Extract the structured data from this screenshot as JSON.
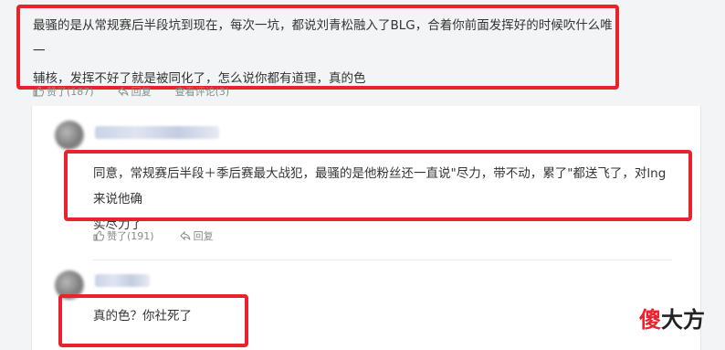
{
  "top_comment": {
    "text_line1": "最骚的是从常规赛后半段坑到现在，每次一坑，都说刘青松融入了BLG，合着你前面发挥好的时候吹什么唯一",
    "text_line2": "辅核，发挥不好了就是被同化了，怎么说你都有道理，真的色",
    "likes": "赞了(187)",
    "reply": "回复",
    "view_replies": "查看评论(3)"
  },
  "reply_1": {
    "text_line1": "同意，常规赛后半段＋季后赛最大战犯，最骚的是他粉丝还一直说\"尽力，带不动，累了\"都送飞了，对lng来说他确",
    "text_line2": "实尽力了",
    "likes": "赞了(191)",
    "reply": "回复"
  },
  "reply_2": {
    "text": "真的色？你社死了"
  },
  "watermark": {
    "first_char": "傻",
    "rest": "大方"
  },
  "colors": {
    "highlight_box": "#e8232b",
    "background": "#f3f4f6",
    "card": "#ffffff"
  }
}
